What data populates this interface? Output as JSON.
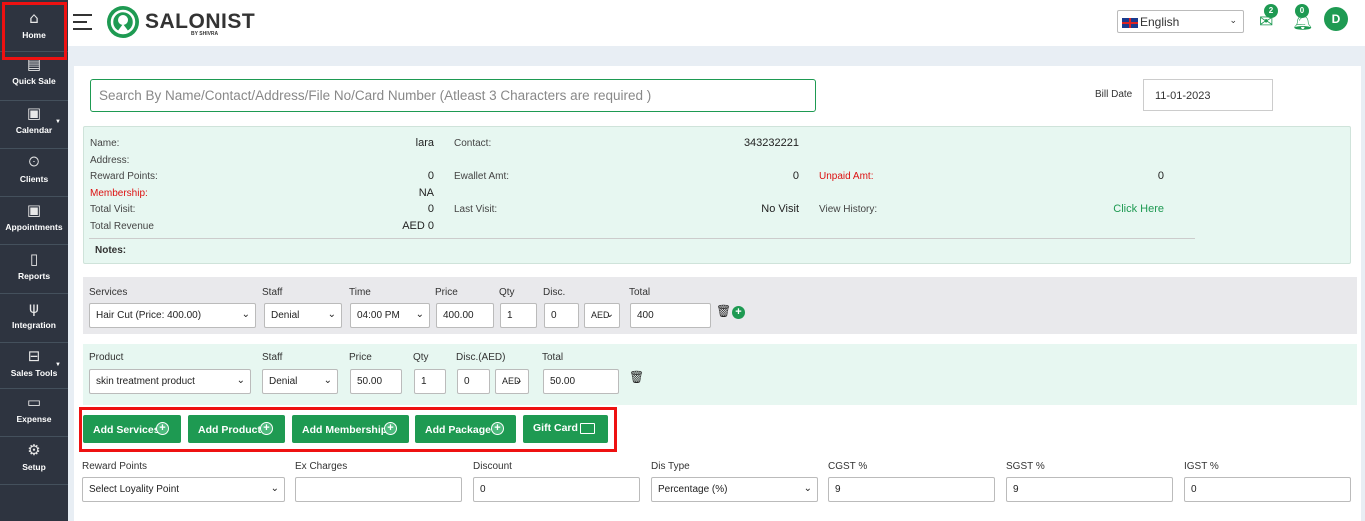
{
  "sidebar": {
    "items": [
      {
        "label": "Home",
        "icon": "home-icon",
        "glyph": "⌂"
      },
      {
        "label": "Quick Sale",
        "icon": "quick-sale-icon",
        "glyph": "▤"
      },
      {
        "label": "Calendar",
        "icon": "calendar-icon",
        "glyph": "▣"
      },
      {
        "label": "Clients",
        "icon": "clients-icon",
        "glyph": "ꖴ"
      },
      {
        "label": "Appointments",
        "icon": "appointments-icon",
        "glyph": "▣"
      },
      {
        "label": "Reports",
        "icon": "reports-icon",
        "glyph": "▯"
      },
      {
        "label": "Integration",
        "icon": "plug-icon",
        "glyph": "ψ"
      },
      {
        "label": "Sales Tools",
        "icon": "briefcase-icon",
        "glyph": "⊟"
      },
      {
        "label": "Expense",
        "icon": "money-icon",
        "glyph": "▭"
      },
      {
        "label": "Setup",
        "icon": "gear-icon",
        "glyph": "⚙"
      }
    ]
  },
  "header": {
    "logo": "SALONIST",
    "logo_sub": "BY SHIVRA",
    "language": "English",
    "mail_count": "2",
    "notif_count": "0",
    "avatar": "D"
  },
  "search": {
    "placeholder": "Search By Name/Contact/Address/File No/Card Number (Atleast 3 Characters are required )"
  },
  "bill": {
    "label": "Bill Date",
    "date": "11-01-2023"
  },
  "client": {
    "name_lbl": "Name:",
    "name": "lara",
    "address_lbl": "Address:",
    "reward_lbl": "Reward Points:",
    "reward": "0",
    "membership_lbl": "Membership:",
    "membership": "NA",
    "total_visit_lbl": "Total Visit:",
    "total_visit": "0",
    "total_revenue_lbl": "Total Revenue",
    "total_revenue": "AED 0",
    "contact_lbl": "Contact:",
    "contact": "343232221",
    "ewallet_lbl": "Ewallet Amt:",
    "ewallet": "0",
    "last_visit_lbl": "Last Visit:",
    "last_visit": "No Visit",
    "unpaid_lbl": "Unpaid Amt:",
    "unpaid": "0",
    "history_lbl": "View History:",
    "history_link": "Click Here",
    "notes_lbl": "Notes:"
  },
  "services": {
    "headers": {
      "services": "Services",
      "staff": "Staff",
      "time": "Time",
      "price": "Price",
      "qty": "Qty",
      "disc": "Disc.",
      "total": "Total"
    },
    "service": "Hair Cut (Price: 400.00)",
    "staff": "Denial",
    "time": "04:00 PM",
    "price": "400.00",
    "qty": "1",
    "disc": "0",
    "disc_type": "AED",
    "total": "400"
  },
  "product": {
    "headers": {
      "product": "Product",
      "staff": "Staff",
      "price": "Price",
      "qty": "Qty",
      "disc": "Disc.(AED)",
      "total": "Total"
    },
    "product": "skin treatment product",
    "staff": "Denial",
    "price": "50.00",
    "qty": "1",
    "disc": "0",
    "disc_type": "AED",
    "total": "50.00"
  },
  "buttons": {
    "add_services": "Add Services",
    "add_product": "Add Product",
    "add_membership": "Add Membership",
    "add_package": "Add Package",
    "gift_card": "Gift Card"
  },
  "footer": {
    "reward_lbl": "Reward Points",
    "reward_val": "Select Loyality Point",
    "ex_lbl": "Ex Charges",
    "ex_val": "",
    "discount_lbl": "Discount",
    "discount_val": "0",
    "dis_type_lbl": "Dis Type",
    "dis_type_val": "Percentage (%)",
    "cgst_lbl": "CGST %",
    "cgst_val": "9",
    "sgst_lbl": "SGST %",
    "sgst_val": "9",
    "igst_lbl": "IGST %",
    "igst_val": "0"
  }
}
